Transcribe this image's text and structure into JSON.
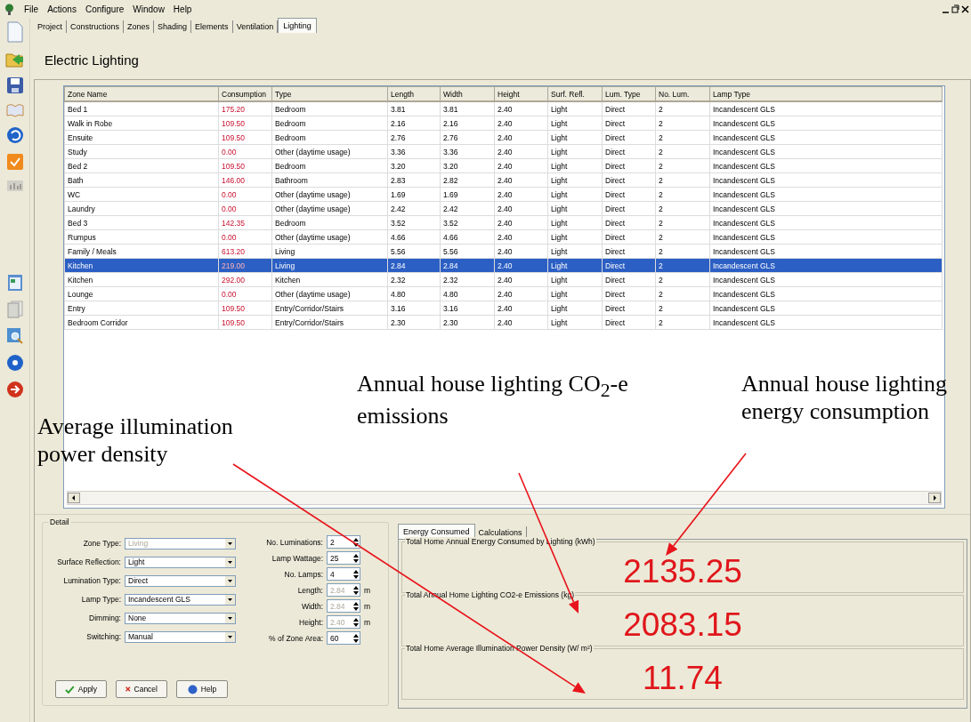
{
  "menu": [
    "File",
    "Actions",
    "Configure",
    "Window",
    "Help"
  ],
  "tabs": [
    {
      "label": "Project",
      "selected": false
    },
    {
      "label": "Constructions",
      "selected": false
    },
    {
      "label": "Zones",
      "selected": false
    },
    {
      "label": "Shading",
      "selected": false
    },
    {
      "label": "Elements",
      "selected": false
    },
    {
      "label": "Ventilation",
      "selected": false
    },
    {
      "label": "Lighting",
      "selected": true
    }
  ],
  "page_title": "Electric Lighting",
  "table": {
    "columns": [
      "Zone Name",
      "Consumption",
      "Type",
      "Length",
      "Width",
      "Height",
      "Surf. Refl.",
      "Lum. Type",
      "No. Lum.",
      "Lamp Type"
    ],
    "rows": [
      {
        "selected": false,
        "cells": [
          "Bed 1",
          "175.20",
          "Bedroom",
          "3.81",
          "3.81",
          "2.40",
          "Light",
          "Direct",
          "2",
          "Incandescent GLS"
        ]
      },
      {
        "selected": false,
        "cells": [
          "Walk in Robe",
          "109.50",
          "Bedroom",
          "2.16",
          "2.16",
          "2.40",
          "Light",
          "Direct",
          "2",
          "Incandescent GLS"
        ]
      },
      {
        "selected": false,
        "cells": [
          "Ensuite",
          "109.50",
          "Bedroom",
          "2.76",
          "2.76",
          "2.40",
          "Light",
          "Direct",
          "2",
          "Incandescent GLS"
        ]
      },
      {
        "selected": false,
        "cells": [
          "Study",
          "0.00",
          "Other (daytime usage)",
          "3.36",
          "3.36",
          "2.40",
          "Light",
          "Direct",
          "2",
          "Incandescent GLS"
        ]
      },
      {
        "selected": false,
        "cells": [
          "Bed 2",
          "109.50",
          "Bedroom",
          "3.20",
          "3.20",
          "2.40",
          "Light",
          "Direct",
          "2",
          "Incandescent GLS"
        ]
      },
      {
        "selected": false,
        "cells": [
          "Bath",
          "146.00",
          "Bathroom",
          "2.83",
          "2.82",
          "2.40",
          "Light",
          "Direct",
          "2",
          "Incandescent GLS"
        ]
      },
      {
        "selected": false,
        "cells": [
          "WC",
          "0.00",
          "Other (daytime usage)",
          "1.69",
          "1.69",
          "2.40",
          "Light",
          "Direct",
          "2",
          "Incandescent GLS"
        ]
      },
      {
        "selected": false,
        "cells": [
          "Laundry",
          "0.00",
          "Other (daytime usage)",
          "2.42",
          "2.42",
          "2.40",
          "Light",
          "Direct",
          "2",
          "Incandescent GLS"
        ]
      },
      {
        "selected": false,
        "cells": [
          "Bed 3",
          "142.35",
          "Bedroom",
          "3.52",
          "3.52",
          "2.40",
          "Light",
          "Direct",
          "2",
          "Incandescent GLS"
        ]
      },
      {
        "selected": false,
        "cells": [
          "Rumpus",
          "0.00",
          "Other (daytime usage)",
          "4.66",
          "4.66",
          "2.40",
          "Light",
          "Direct",
          "2",
          "Incandescent GLS"
        ]
      },
      {
        "selected": false,
        "cells": [
          "Family / Meals",
          "613.20",
          "Living",
          "5.56",
          "5.56",
          "2.40",
          "Light",
          "Direct",
          "2",
          "Incandescent GLS"
        ]
      },
      {
        "selected": true,
        "cells": [
          "Kitchen",
          "219.00",
          "Living",
          "2.84",
          "2.84",
          "2.40",
          "Light",
          "Direct",
          "2",
          "Incandescent GLS"
        ]
      },
      {
        "selected": false,
        "cells": [
          "Kitchen",
          "292.00",
          "Kitchen",
          "2.32",
          "2.32",
          "2.40",
          "Light",
          "Direct",
          "2",
          "Incandescent GLS"
        ]
      },
      {
        "selected": false,
        "cells": [
          "Lounge",
          "0.00",
          "Other (daytime usage)",
          "4.80",
          "4.80",
          "2.40",
          "Light",
          "Direct",
          "2",
          "Incandescent GLS"
        ]
      },
      {
        "selected": false,
        "cells": [
          "Entry",
          "109.50",
          "Entry/Corridor/Stairs",
          "3.16",
          "3.16",
          "2.40",
          "Light",
          "Direct",
          "2",
          "Incandescent GLS"
        ]
      },
      {
        "selected": false,
        "cells": [
          "Bedroom Corridor",
          "109.50",
          "Entry/Corridor/Stairs",
          "2.30",
          "2.30",
          "2.40",
          "Light",
          "Direct",
          "2",
          "Incandescent GLS"
        ]
      }
    ]
  },
  "detail": {
    "title": "Detail",
    "combos": [
      {
        "label": "Zone Type:",
        "value": "Living",
        "disabled": true
      },
      {
        "label": "Surface Reflection:",
        "value": "Light",
        "disabled": false
      },
      {
        "label": "Lumination Type:",
        "value": "Direct",
        "disabled": false
      },
      {
        "label": "Lamp Type:",
        "value": "Incandescent GLS",
        "disabled": false
      },
      {
        "label": "Dimming:",
        "value": "None",
        "disabled": false
      },
      {
        "label": "Switching:",
        "value": "Manual",
        "disabled": false
      }
    ],
    "spinners": [
      {
        "label": "No. Luminations:",
        "value": "2",
        "disabled": false
      },
      {
        "label": "Lamp Wattage:",
        "value": "25",
        "disabled": false
      },
      {
        "label": "No. Lamps:",
        "value": "4",
        "disabled": false
      },
      {
        "label": "Length:",
        "value": "2.84",
        "disabled": true,
        "unit": "m"
      },
      {
        "label": "Width:",
        "value": "2.84",
        "disabled": true,
        "unit": "m"
      },
      {
        "label": "Height:",
        "value": "2.40",
        "disabled": true,
        "unit": "m"
      },
      {
        "label": "% of Zone Area:",
        "value": "60",
        "disabled": false
      }
    ],
    "buttons": [
      {
        "label": "Apply",
        "kind": "apply"
      },
      {
        "label": "Cancel",
        "kind": "cancel"
      },
      {
        "label": "Help",
        "kind": "help"
      }
    ]
  },
  "results": {
    "tabs": [
      {
        "label": "Energy Consumed",
        "selected": true
      },
      {
        "label": "Calculations",
        "selected": false
      }
    ],
    "groups": [
      {
        "title": "Total Home Annual Energy Consumed by Lighting (kWh)",
        "value": "2135.25"
      },
      {
        "title": "Total Annual Home Lighting CO2-e Emissions (kg)",
        "value": "2083.15"
      },
      {
        "title": "Total Home Average Illumination Power Density (W/ m²)",
        "value": "11.74"
      }
    ]
  },
  "annotations": [
    {
      "text": "Annual house lighting CO$_{2}$-e emissions"
    },
    {
      "text": "Annual house lighting energy consumption"
    },
    {
      "text": "Average illumination power density"
    }
  ]
}
